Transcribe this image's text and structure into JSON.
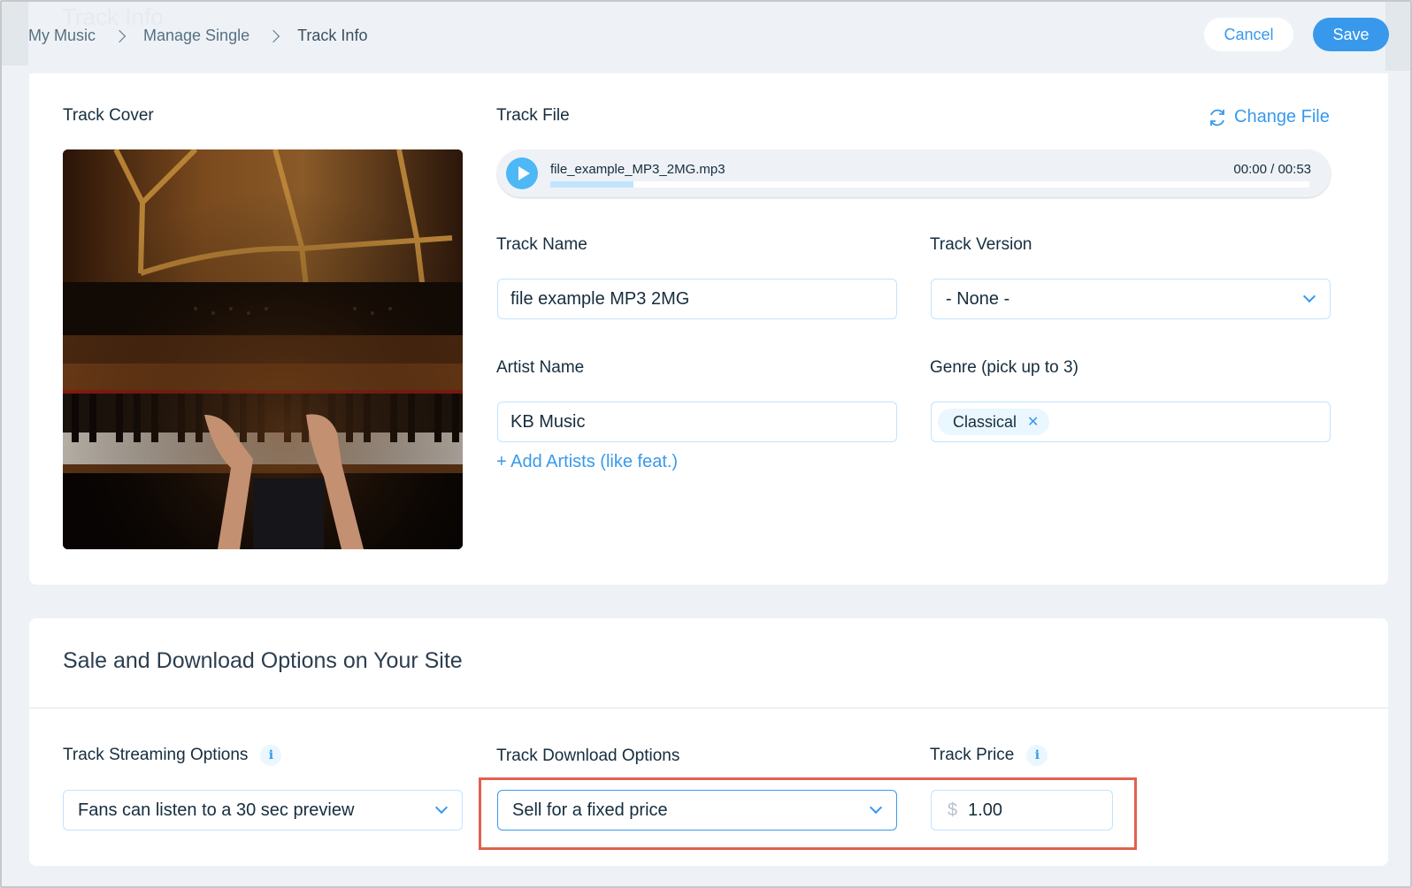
{
  "header": {
    "ghost_title": "Track Info",
    "breadcrumb": [
      "My Music",
      "Manage Single",
      "Track Info"
    ],
    "cancel_label": "Cancel",
    "save_label": "Save"
  },
  "track_details": {
    "cover_label": "Track Cover",
    "cover_image_desc": "Hands playing a grand piano (dark photo)",
    "file_label": "Track File",
    "change_file_label": "Change File",
    "player": {
      "file_name": "file_example_MP3_2MG.mp3",
      "current_time": "00:00",
      "duration": "00:53",
      "time_display": "00:00 / 00:53",
      "buffered_fraction": 0.11
    },
    "track_name": {
      "label": "Track Name",
      "value": "file example MP3 2MG"
    },
    "track_version": {
      "label": "Track Version",
      "value": "- None -"
    },
    "artist_name": {
      "label": "Artist Name",
      "value": "KB Music"
    },
    "add_artists_label": "+ Add Artists (like feat.)",
    "genre": {
      "label": "Genre (pick up to 3)",
      "tags": [
        "Classical"
      ]
    }
  },
  "sale_options": {
    "title": "Sale and Download Options on Your Site",
    "streaming": {
      "label": "Track Streaming Options",
      "value": "Fans can listen to a 30 sec preview"
    },
    "download": {
      "label": "Track Download Options",
      "value": "Sell for a fixed price"
    },
    "price": {
      "label": "Track Price",
      "currency": "$",
      "value": "1.00"
    }
  },
  "colors": {
    "accent": "#3899ec",
    "highlight_box": "#e3604d",
    "page_bg": "#eef2f6"
  }
}
